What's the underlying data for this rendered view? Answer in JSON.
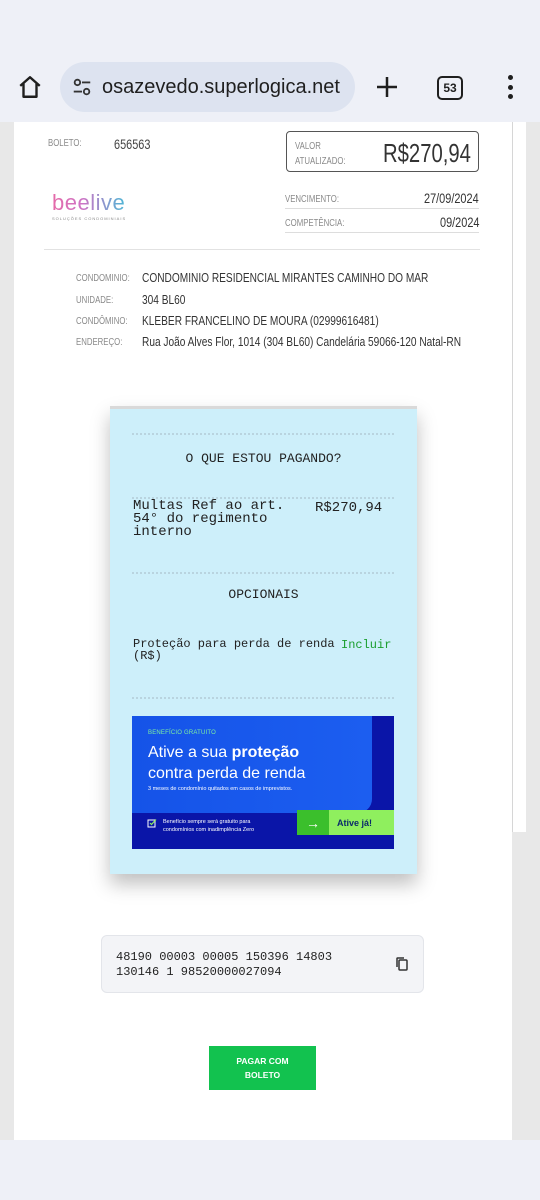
{
  "browser": {
    "url": "osazevedo.superlogica.net",
    "tab_count": "53"
  },
  "header": {
    "boleto_label": "BOLETO:",
    "boleto_number": "656563",
    "valor_label_1": "VALOR",
    "valor_label_2": "ATUALIZADO:",
    "valor": "R$270,94",
    "logo_text": "beelive",
    "logo_subtitle": "SOLUÇÕES CONDOMINIAIS",
    "vencimento_label": "VENCIMENTO:",
    "vencimento": "27/09/2024",
    "competencia_label": "COMPETÊNCIA:",
    "competencia": "09/2024"
  },
  "details": [
    {
      "label": "CONDOMINIO:",
      "value": "CONDOMINIO RESIDENCIAL MIRANTES CAMINHO DO MAR"
    },
    {
      "label": "UNIDADE:",
      "value": "304 BL60"
    },
    {
      "label": "CONDÔMINO:",
      "value": "KLEBER FRANCELINO DE MOURA (02999616481)"
    },
    {
      "label": "ENDEREÇO:",
      "value": "Rua João Alves Flor, 1014 (304 BL60) Candelária 59066-120 Natal-RN"
    }
  ],
  "receipt": {
    "title": "O QUE ESTOU PAGANDO?",
    "item_description": "Multas Ref ao art. 54° do regimento interno",
    "item_amount": "R$270,94",
    "optionals_title": "OPCIONAIS",
    "protection_label": "Proteção para perda de renda (R$)",
    "include_link": "Incluir"
  },
  "banner": {
    "tag": "BENEFÍCIO GRATUITO",
    "headline_1": "Ative a sua ",
    "headline_bold": "proteção",
    "headline_2": "contra perda de renda",
    "subtext": "3 meses de condomínio quitados em casos de imprevistos.",
    "footer": "Benefício sempre será gratuito para condomínios com inadimplência Zero",
    "cta": "Ative já!"
  },
  "barcode": {
    "line_1": "48190 00003 00005 150396 14803",
    "line_2": "130146 1 98520000027094"
  },
  "pay_button": {
    "line_1": "PAGAR COM",
    "line_2": "BOLETO"
  },
  "colors": {
    "receipt_bg": "#cdeffa",
    "banner_blue": "#1553e8",
    "pay_green": "#12c24f",
    "include_green": "#1a9e2e"
  }
}
